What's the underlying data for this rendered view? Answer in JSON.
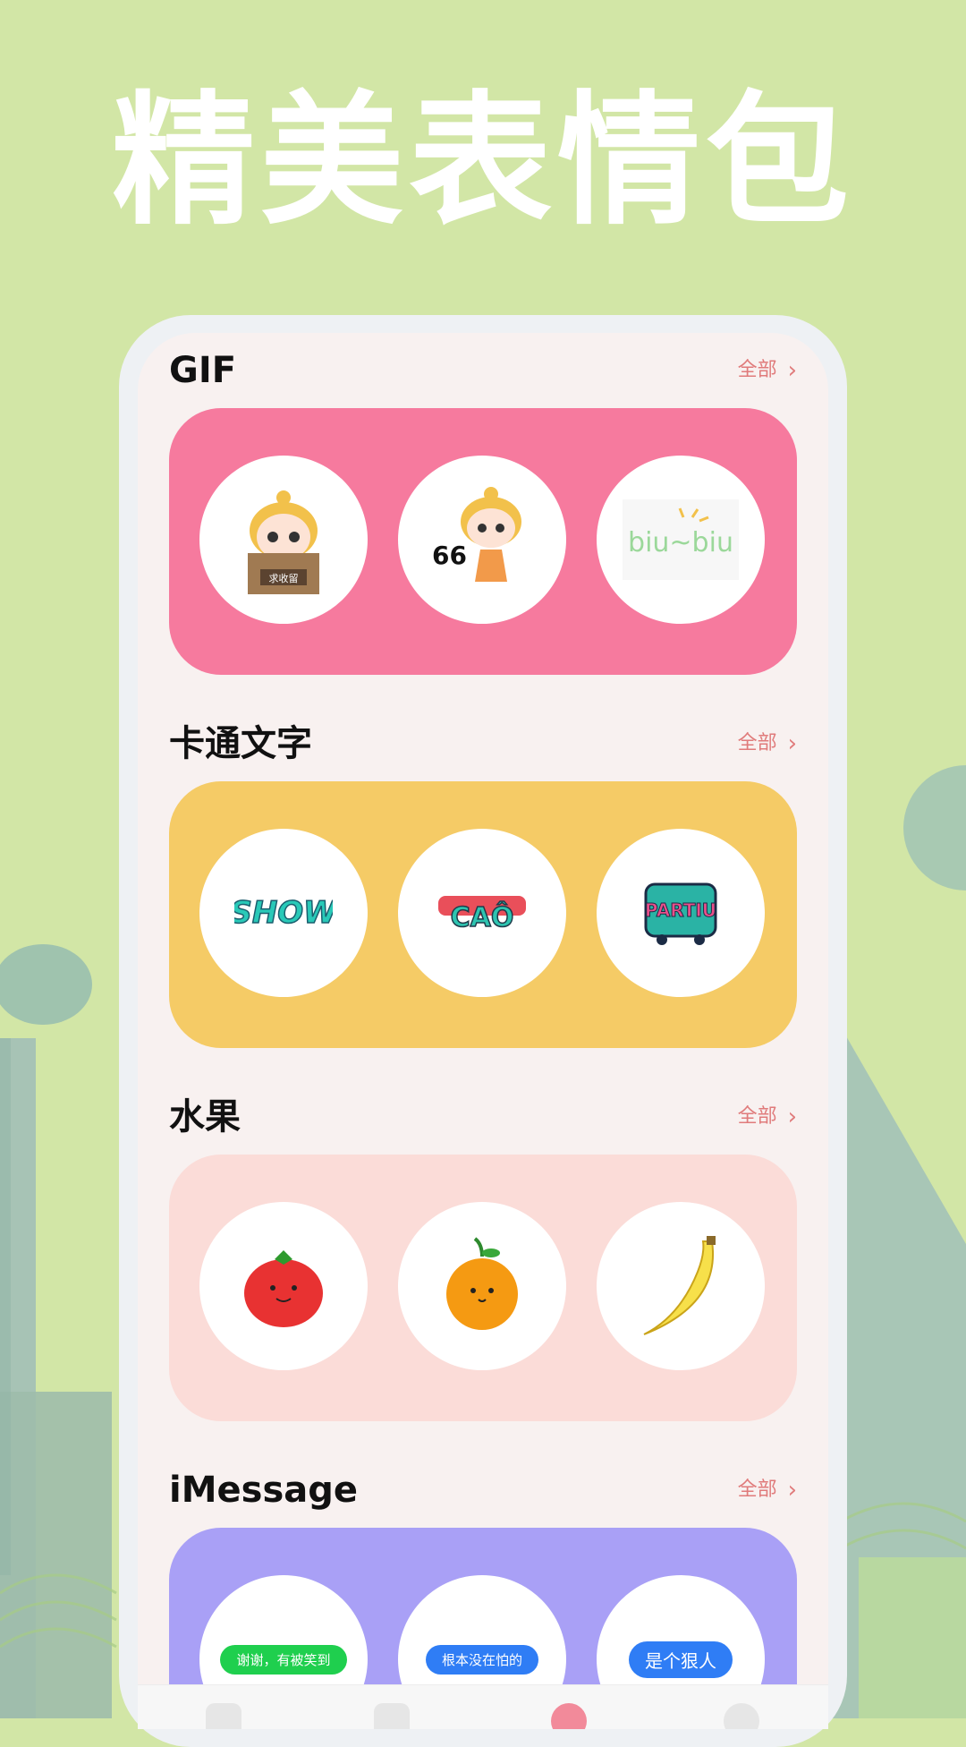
{
  "hero": {
    "title": "精美表情包"
  },
  "sections": [
    {
      "title": "GIF",
      "more": "全部",
      "items": [
        "求收留",
        "66",
        "biu~biu"
      ]
    },
    {
      "title": "卡通文字",
      "more": "全部",
      "items": [
        "SHOW",
        "CAÔ",
        "PARTIU"
      ]
    },
    {
      "title": "水果",
      "more": "全部",
      "items": [
        "tomato",
        "orange",
        "banana"
      ]
    },
    {
      "title": "iMessage",
      "more": "全部",
      "items": [
        "谢谢，有被笑到",
        "根本没在怕的",
        "是个狠人"
      ]
    }
  ],
  "colors": {
    "gif_card": "#f67a9e",
    "cartoon_card": "#f5cb66",
    "fruit_card": "#fbdcd8",
    "imessage_card": "#a9a0f6",
    "more_text": "#e07b7b"
  }
}
